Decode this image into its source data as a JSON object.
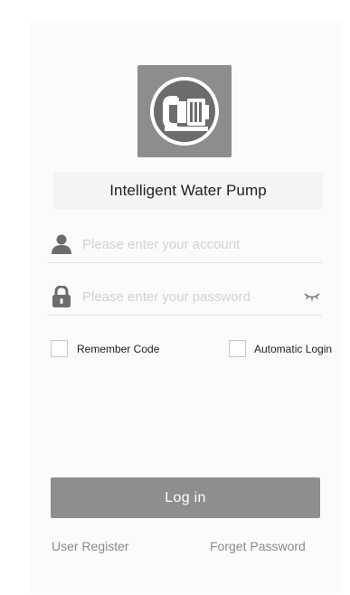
{
  "app": {
    "title": "Intelligent Water Pump",
    "logo_icon": "water-pump-icon"
  },
  "form": {
    "account": {
      "placeholder": "Please enter your account",
      "value": "",
      "icon": "user-icon"
    },
    "password": {
      "placeholder": "Please enter your password",
      "value": "",
      "icon": "lock-icon",
      "toggle_icon": "eye-closed-icon"
    },
    "remember_code": {
      "label": "Remember Code",
      "checked": false
    },
    "automatic_login": {
      "label": "Automatic Login",
      "checked": false
    },
    "login_label": "Log in"
  },
  "links": {
    "register": "User Register",
    "forget": "Forget Password"
  },
  "colors": {
    "primary_gray": "#8e8e8e",
    "icon_dark": "#6c6c6c",
    "placeholder": "#d2d2d2",
    "divider": "#e4e4e4"
  }
}
